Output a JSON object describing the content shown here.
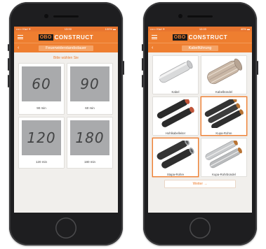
{
  "left_phone": {
    "status": {
      "carrier": "••••○ Kiwi ✈",
      "time": "13:00",
      "battery": "100% ▬"
    },
    "brand": {
      "logo_text": "OBO",
      "name": "CONSTRUCT"
    },
    "title": "Feuerwiderstandsdauer",
    "hint": "Bitte wählen Sie",
    "tiles": [
      {
        "number": "60",
        "caption": "90 min"
      },
      {
        "number": "90",
        "caption": "60 min"
      },
      {
        "number": "120",
        "caption": "120 min"
      },
      {
        "number": "180",
        "caption": "180 min"
      }
    ]
  },
  "right_phone": {
    "status": {
      "carrier": "••••○ Kiwi ✈",
      "time": "10:03",
      "battery": "40% ▬"
    },
    "brand": {
      "logo_text": "OBO",
      "name": "CONSTRUCT"
    },
    "title": "Kabelführung",
    "tiles": [
      {
        "caption": "Kabel",
        "icon": "cable-icon",
        "selected": false
      },
      {
        "caption": "Kabelbündel",
        "icon": "cable-bundle-icon",
        "selected": false
      },
      {
        "caption": "Hohlkabelleiter",
        "icon": "hollow-conductor-icon",
        "selected": false
      },
      {
        "caption": "Kupa-Rohre",
        "icon": "copper-pipe-icon",
        "selected": true
      },
      {
        "caption": "Stapa-Rohre",
        "icon": "steel-pipe-icon",
        "selected": true
      },
      {
        "caption": "Kupa-Rohrbündel",
        "icon": "copper-pipe-bundle-icon",
        "selected": false
      }
    ],
    "next_label": "Weiter →"
  },
  "colors": {
    "accent": "#ee7e30",
    "tile_grey": "#a9aaac",
    "background": "#f1efec"
  }
}
